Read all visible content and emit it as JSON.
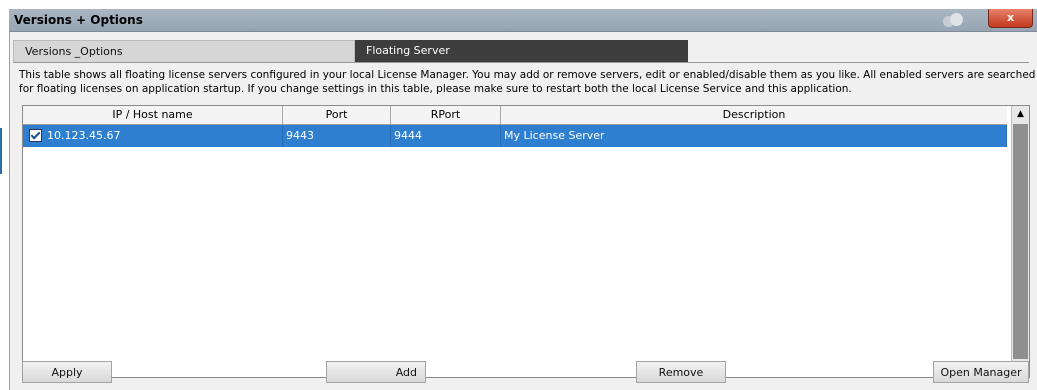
{
  "window": {
    "title": "Versions + Options",
    "close_label": "x"
  },
  "tabs": [
    {
      "label": "Versions _Options"
    },
    {
      "label": "Floating Server"
    }
  ],
  "description": {
    "line1": "This table shows all floating license servers configured in your local License Manager. You may add or remove servers, edit or enabled/disable them as you like. All enabled servers are searched",
    "line2": "for floating licenses on application startup. If you change settings in this table, please make sure to restart both the local License Service and this application."
  },
  "table": {
    "columns": [
      "IP / Host name",
      "Port",
      "RPort",
      "Description"
    ],
    "rows": [
      {
        "enabled": true,
        "host": "10.123.45.67",
        "port": "9443",
        "rport": "9444",
        "description": "My License Server"
      }
    ]
  },
  "buttons": {
    "apply": "Apply",
    "add": "Add",
    "remove": "Remove",
    "open_manager": "Open Manager"
  },
  "colors": {
    "selection": "#2f7fd0",
    "active_tab": "#3d3d3d",
    "close_button": "#c2391d"
  }
}
